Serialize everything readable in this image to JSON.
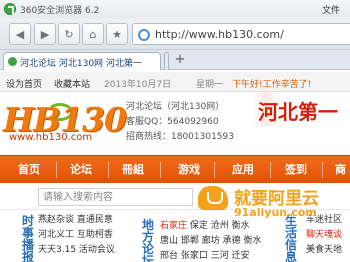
{
  "browser": {
    "title": "360安全浏览器 6.2",
    "file_menu": "文件",
    "address": "http://www.hb130.com/",
    "active_tab": "河北论坛 河北130网 河北第一",
    "new_tab": "+"
  },
  "topbar": {
    "set_home": "设为首页",
    "favorite": "收藏本站",
    "date": "2013年10月7日",
    "weekday": "星期一",
    "slogan": "下午好!工作辛苦了!"
  },
  "header": {
    "logo_text": "HB130",
    "logo_url": "www.hb130.com",
    "site_name": "河北论坛（河北130网）",
    "qq": "客服QQ：564092960",
    "hotline": "招商热线：18001301593",
    "banner": "河北第一"
  },
  "nav": [
    "首页",
    "论坛",
    "冊組",
    "游戏",
    "应用",
    "签到",
    "商"
  ],
  "search": {
    "placeholder": "请输入搜索内容"
  },
  "content": {
    "sec_left": "时事播报",
    "sec_mid": "地方论坛",
    "sec_right": "生活信息",
    "news": [
      "燕赵杂谈 直通民意",
      "河北义工 互助柯香",
      "天天3.15 活动会议"
    ],
    "cities_row1_hot": "石家庄",
    "cities_row1": "保定 沧州 衡水",
    "cities_row2": "唐山 邯郸 廊坊 承德 衡水",
    "cities_row3": "邢台 张家口 三河 迁安",
    "right": [
      "车迷社区",
      "聊天魂谈",
      "美食天地"
    ]
  },
  "watermark": {
    "cn": "就要阿里云",
    "url": "91aliyun.com"
  }
}
